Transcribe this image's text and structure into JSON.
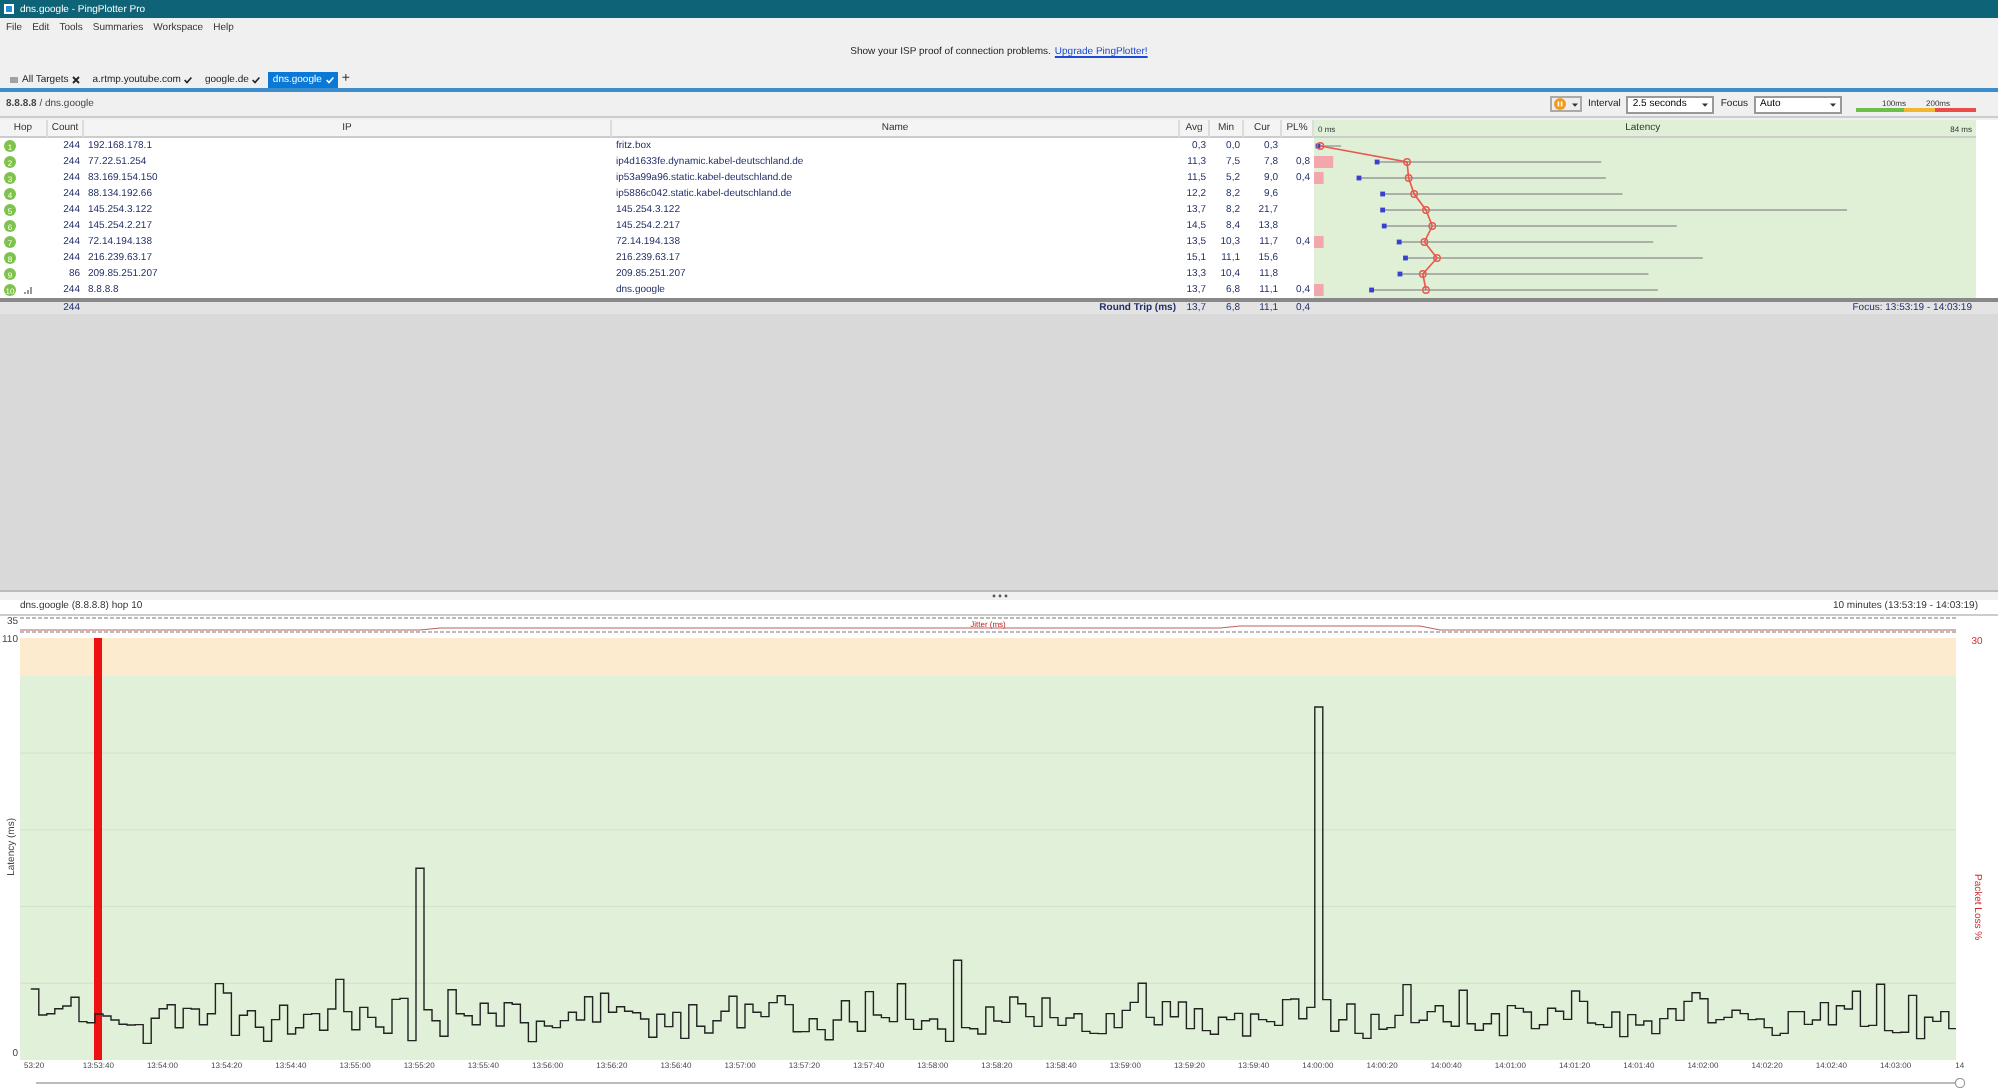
{
  "window": {
    "title": "dns.google - PingPlotter Pro"
  },
  "menu": [
    "File",
    "Edit",
    "Tools",
    "Summaries",
    "Workspace",
    "Help"
  ],
  "notice": {
    "text": "Show your ISP proof of connection problems.",
    "link": "Upgrade PingPlotter!"
  },
  "target_tabs": [
    {
      "label": "All Targets",
      "selected": false,
      "kind": "all"
    },
    {
      "label": "a.rtmp.youtube.com",
      "selected": false,
      "kind": "target"
    },
    {
      "label": "google.de",
      "selected": false,
      "kind": "target"
    },
    {
      "label": "dns.google",
      "selected": true,
      "kind": "target"
    }
  ],
  "add_tab": "+",
  "target": {
    "ip": "8.8.8.8",
    "separator": "/",
    "name": "dns.google"
  },
  "toolbar": {
    "interval_label": "Interval",
    "interval": "2.5 seconds",
    "focus_label": "Focus",
    "focus": "Auto",
    "legend": [
      "100ms",
      "200ms"
    ]
  },
  "table": {
    "columns": [
      "Hop",
      "Count",
      "IP",
      "Name",
      "Avg",
      "Min",
      "Cur",
      "PL%",
      "Latency"
    ],
    "scale_min": "0 ms",
    "scale_max": "84 ms",
    "rows": [
      {
        "hop": "1",
        "kind": "hop",
        "count": "244",
        "ip": "192.168.178.1",
        "name": "fritz.box",
        "avg": "0,3",
        "min": "0,0",
        "cur": "0,3"
      },
      {
        "hop": "2",
        "kind": "hop",
        "count": "244",
        "ip": "77.22.51.254",
        "name": "ip4d1633fe.dynamic.kabel-deutschland.de",
        "avg": "11,3",
        "min": "7,5",
        "cur": "7,8",
        "pl": "0,8"
      },
      {
        "hop": "3",
        "kind": "hop",
        "count": "244",
        "ip": "83.169.154.150",
        "name": "ip53a99a96.static.kabel-deutschland.de",
        "avg": "11,5",
        "min": "5,2",
        "cur": "9,0",
        "pl": "0,4"
      },
      {
        "hop": "4",
        "kind": "hop",
        "count": "244",
        "ip": "88.134.192.66",
        "name": "ip5886c042.static.kabel-deutschland.de",
        "avg": "12,2",
        "min": "8,2",
        "cur": "9,6"
      },
      {
        "hop": "5",
        "kind": "hop",
        "count": "244",
        "ip": "145.254.3.122",
        "name": "145.254.3.122",
        "avg": "13,7",
        "min": "8,2",
        "cur": "21,7"
      },
      {
        "hop": "6",
        "kind": "hop",
        "count": "244",
        "ip": "145.254.2.217",
        "name": "145.254.2.217",
        "avg": "14,5",
        "min": "8,4",
        "cur": "13,8"
      },
      {
        "hop": "7",
        "kind": "hop",
        "count": "244",
        "ip": "72.14.194.138",
        "name": "72.14.194.138",
        "avg": "13,5",
        "min": "10,3",
        "cur": "11,7",
        "pl": "0,4"
      },
      {
        "hop": "8",
        "kind": "hop",
        "count": "244",
        "ip": "216.239.63.17",
        "name": "216.239.63.17",
        "avg": "15,1",
        "min": "11,1",
        "cur": "15,6"
      },
      {
        "hop": "9",
        "kind": "hop",
        "count": "86",
        "ip": "209.85.251.207",
        "name": "209.85.251.207",
        "avg": "13,3",
        "min": "10,4",
        "cur": "11,8"
      },
      {
        "hop": "10",
        "kind": "target",
        "count": "244",
        "ip": "8.8.8.8",
        "name": "dns.google",
        "avg": "13,7",
        "min": "6,8",
        "cur": "11,1",
        "pl": "0,4"
      }
    ],
    "summary": {
      "count": "244",
      "label": "Round Trip (ms)",
      "avg": "13,7",
      "min": "6,8",
      "cur": "11,1",
      "pl": "0,4",
      "focus": "Focus: 13:53:19 - 14:03:19"
    }
  },
  "graph": {
    "title": "dns.google (8.8.8.8) hop 10",
    "range": "10 minutes (13:53:19 - 14:03:19)",
    "jitter_label": "Jitter (ms)",
    "jitter_max": "35",
    "y_max": "110",
    "y_min": "0",
    "ylabel": "Latency (ms)",
    "y2label": "Packet Loss %",
    "y2_max": "30",
    "xticks": [
      "53:20",
      "13:53:40",
      "13:54:00",
      "13:54:20",
      "13:54:40",
      "13:55:00",
      "13:55:20",
      "13:55:40",
      "13:56:00",
      "13:56:20",
      "13:56:40",
      "13:57:00",
      "13:57:20",
      "13:57:40",
      "13:58:00",
      "13:58:20",
      "13:58:40",
      "13:59:00",
      "13:59:20",
      "13:59:40",
      "14:00:00",
      "14:00:20",
      "14:00:40",
      "14:01:00",
      "14:01:20",
      "14:01:40",
      "14:02:00",
      "14:02:20",
      "14:02:40",
      "14:03:00",
      "14"
    ]
  }
}
